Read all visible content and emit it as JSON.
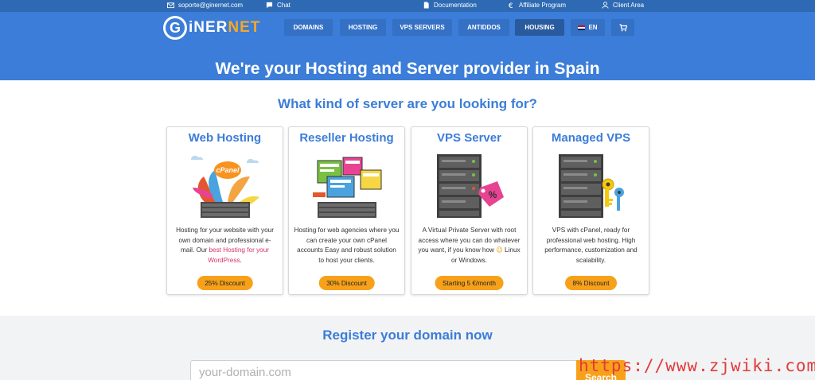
{
  "topbar": {
    "email": "soporte@ginernet.com",
    "chat": "Chat",
    "documentation": "Documentation",
    "affiliate": "Affiliate Program",
    "client_area": "Client Area"
  },
  "logo": {
    "initial": "G",
    "text_main": "iNER",
    "text_accent": "NET"
  },
  "nav": {
    "domains": "DOMAINS",
    "hosting": "HOSTING",
    "vps_servers": "VPS SERVERS",
    "antiddos": "ANTIDDOS",
    "housing": "HOUSING",
    "language": "EN"
  },
  "hero": {
    "title": "We're your Hosting and Server provider in Spain"
  },
  "servers": {
    "title": "What kind of server are you looking for?",
    "cards": [
      {
        "title": "Web Hosting",
        "desc_before": "Hosting for your website with your own domain and professional e-mail. Our ",
        "desc_link": "best Hosting for your WordPress",
        "desc_after": ".",
        "button": "25% Discount",
        "icon": "cpanel-illustration"
      },
      {
        "title": "Reseller Hosting",
        "desc": "Hosting for web agencies where you can create your own cPanel accounts Easy and robust solution to host your clients.",
        "button": "30% Discount",
        "icon": "reseller-illustration"
      },
      {
        "title": "VPS Server",
        "desc_before": "A Virtual Private Server with root access where you can do whatever you want, if you know how ",
        "desc_emoji": "😉",
        "desc_after": " Linux or Windows.",
        "button": "Starting 5 €/month",
        "icon": "server-rack-illustration"
      },
      {
        "title": "Managed VPS",
        "desc": "VPS with cPanel, ready for professional web hosting. High performance, customization and scalability.",
        "button": "8% Discount",
        "icon": "server-keys-illustration"
      }
    ]
  },
  "domain": {
    "title": "Register your domain now",
    "placeholder": "your-domain.com",
    "search_label": "Search"
  },
  "watermark": "https://www.zjwiki.com",
  "colors": {
    "brand_blue": "#3b7dd8",
    "topbar_blue": "#2e6ab3",
    "accent_orange": "#f7a11a",
    "link_pink": "#d6336c"
  }
}
